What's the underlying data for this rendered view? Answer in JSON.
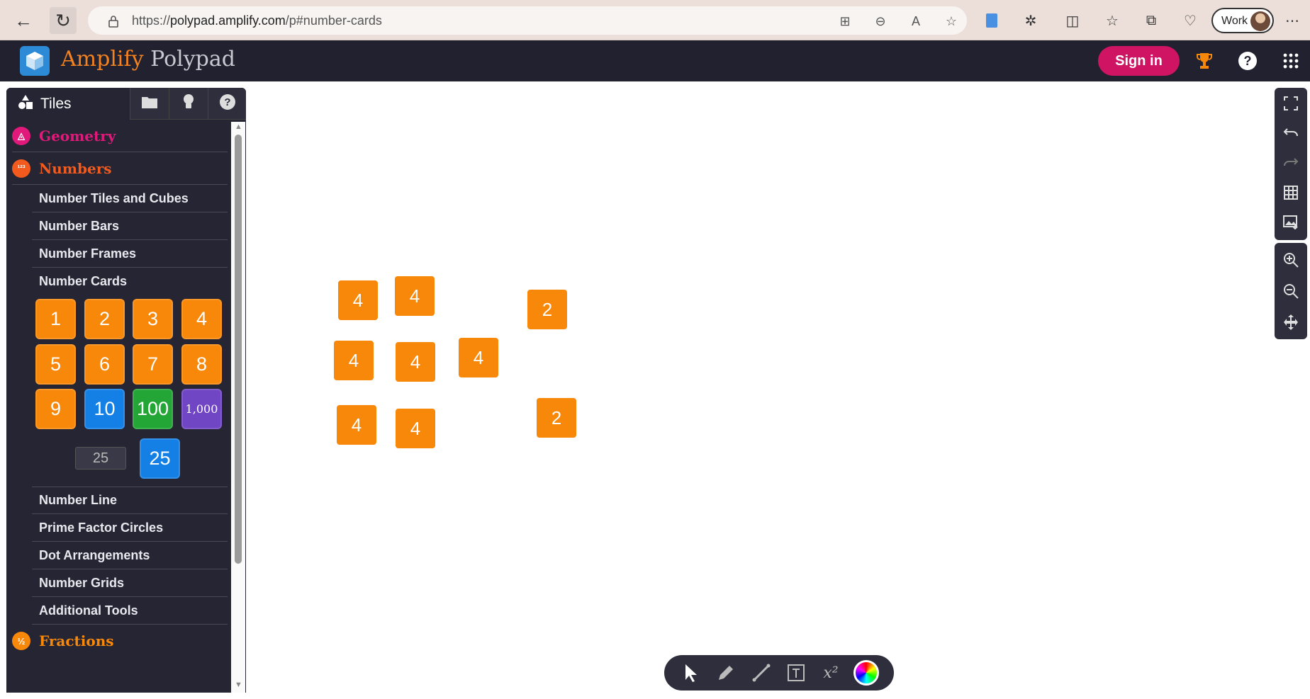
{
  "browser": {
    "url_prefix": "https://",
    "url_domain": "polypad.amplify.com",
    "url_path": "/p#number-cards",
    "profile_label": "Work"
  },
  "header": {
    "brand_main": "Amplify",
    "brand_sub": " Polypad",
    "signin_label": "Sign in",
    "brand_color": "#f4821f",
    "signin_color": "#cf1464"
  },
  "sidebar": {
    "active_tab_label": "Tiles",
    "categories": {
      "geometry": {
        "label": "Geometry",
        "color": "#e0197a"
      },
      "numbers": {
        "label": "Numbers",
        "color": "#f25a1e"
      },
      "fractions": {
        "label": "Fractions",
        "color": "#f7880a"
      }
    },
    "number_items": [
      "Number Tiles and Cubes",
      "Number Bars",
      "Number Frames",
      "Number Cards"
    ],
    "number_items_after": [
      "Number Line",
      "Prime Factor Circles",
      "Dot Arrangements",
      "Number Grids",
      "Additional Tools"
    ],
    "cards": [
      "1",
      "2",
      "3",
      "4",
      "5",
      "6",
      "7",
      "8",
      "9",
      "10",
      "100",
      "1,000"
    ],
    "custom_value": "25",
    "custom_card": "25"
  },
  "canvas": {
    "tiles": [
      "4",
      "4",
      "2",
      "4",
      "4",
      "4",
      "4",
      "4",
      "2"
    ]
  },
  "icons": {
    "right_toolbar": [
      "fullscreen-icon",
      "undo-icon",
      "redo-icon",
      "grid-icon",
      "export-image-icon",
      "zoom-in-icon",
      "zoom-out-icon",
      "pan-icon"
    ],
    "bottom_toolbar": [
      "select-icon",
      "pen-icon",
      "line-icon",
      "text-icon",
      "equation-icon",
      "color-picker-icon"
    ]
  },
  "bottom_toolbar": {
    "equation_label": "x²"
  }
}
